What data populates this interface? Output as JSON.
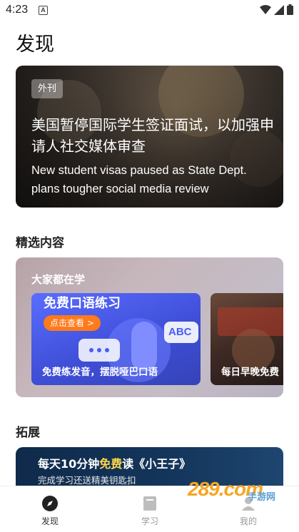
{
  "status_bar": {
    "time": "4:23",
    "notification_badge": "A",
    "icons": [
      "wifi-icon",
      "signal-icon",
      "battery-icon"
    ]
  },
  "page": {
    "title": "发现"
  },
  "hero": {
    "tag": "外刊",
    "title_cn": "美国暂停国际学生签证面试，以加强申请人社交媒体审查",
    "title_en": "New student visas paused as State Dept. plans tougher social media review"
  },
  "featured": {
    "section_title": "精选内容",
    "label": "大家都在学",
    "cards": [
      {
        "title": "免费口语练习",
        "button": "点击查看 >",
        "badge": "ABC",
        "caption": "免费练发音，摆脱哑巴口语"
      },
      {
        "caption": "每日早晚免费"
      }
    ]
  },
  "extend": {
    "section_title": "拓展",
    "title_prefix": "每天10分钟",
    "title_highlight": "免费",
    "title_suffix": "读《小王子》",
    "subtitle": "完成学习还送精美钥匙扣"
  },
  "bottom_nav": [
    {
      "label": "发现",
      "icon": "compass-icon",
      "active": true
    },
    {
      "label": "学习",
      "icon": "book-icon",
      "active": false
    },
    {
      "label": "我的",
      "icon": "profile-icon",
      "active": false
    }
  ],
  "watermark": {
    "text": "289.com",
    "cn": "手游网"
  },
  "colors": {
    "accent_orange": "#ff7a1a",
    "promo_blue": "#4a5cf0",
    "highlight_yellow": "#ffd74a",
    "text_dark": "#111111"
  }
}
